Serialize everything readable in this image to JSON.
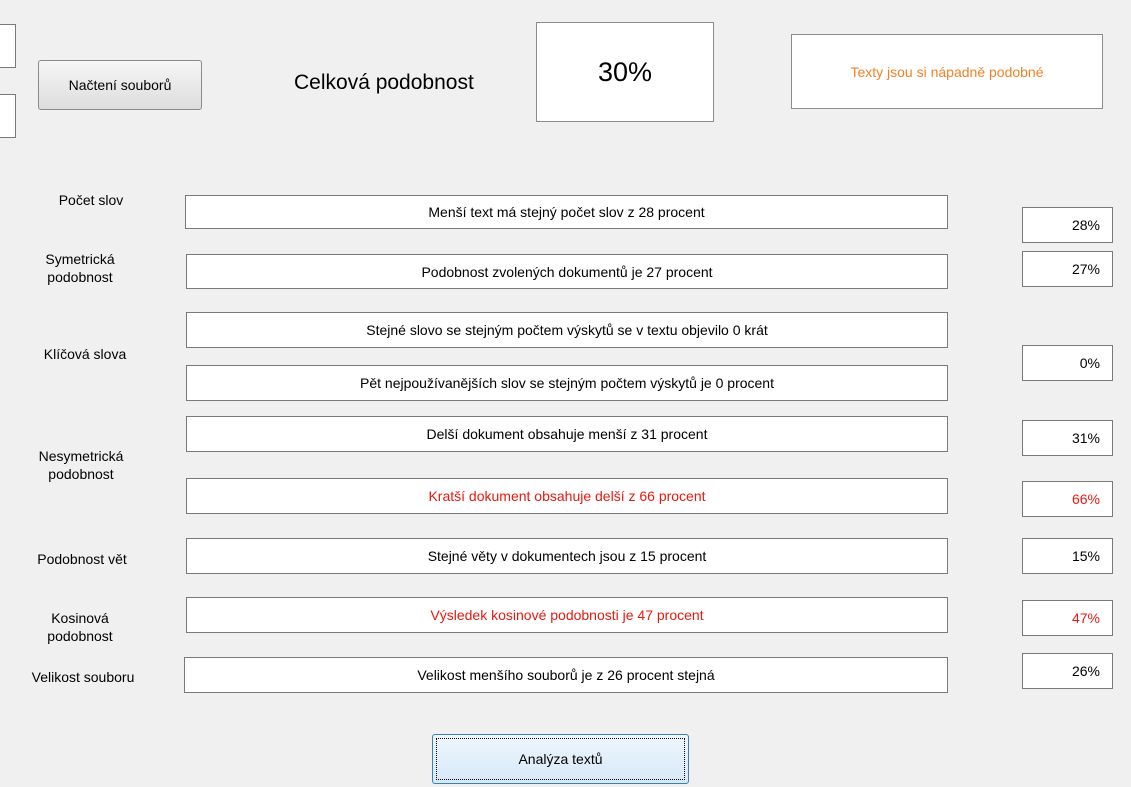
{
  "header": {
    "load_button": "Načtení souborů",
    "overall_label": "Celková podobnost",
    "overall_value": "30%",
    "verdict": "Texty jsou si nápadně podobné",
    "verdict_color": "#f08228"
  },
  "metrics": {
    "word_count": {
      "label": "Počet slov",
      "text": "Menší text má stejný počet slov z 28 procent",
      "value": "28%"
    },
    "symmetric": {
      "label_line1": "Symetrická",
      "label_line2": "podobnost",
      "text": "Podobnost zvolených dokumentů je 27 procent",
      "value": "27%"
    },
    "keywords": {
      "label": "Klíčová slova",
      "text1": "Stejné slovo se stejným počtem výskytů se v textu objevilo 0 krát",
      "text2": "Pět nejpoužívanějších slov se stejným počtem výskytů je 0 procent",
      "value": "0%"
    },
    "asymmetric": {
      "label_line1": "Nesymetrická",
      "label_line2": "podobnost",
      "text1": "Delší dokument obsahuje menší z 31 procent",
      "value1": "31%",
      "text2": "Kratší dokument obsahuje delší z 66 procent",
      "value2": "66%",
      "highlight_color": "#e8190f"
    },
    "sentences": {
      "label": "Podobnost vět",
      "text": "Stejné věty v dokumentech jsou z 15 procent",
      "value": "15%"
    },
    "cosine": {
      "label_line1": "Kosinová",
      "label_line2": "podobnost",
      "text": "Výsledek kosinové podobnosti je 47 procent",
      "value": "47%"
    },
    "file_size": {
      "label": "Velikost souboru",
      "text": "Velikost menšího souborů je z 26 procent stejná",
      "value": "26%"
    }
  },
  "analyze_button": "Analýza textů"
}
